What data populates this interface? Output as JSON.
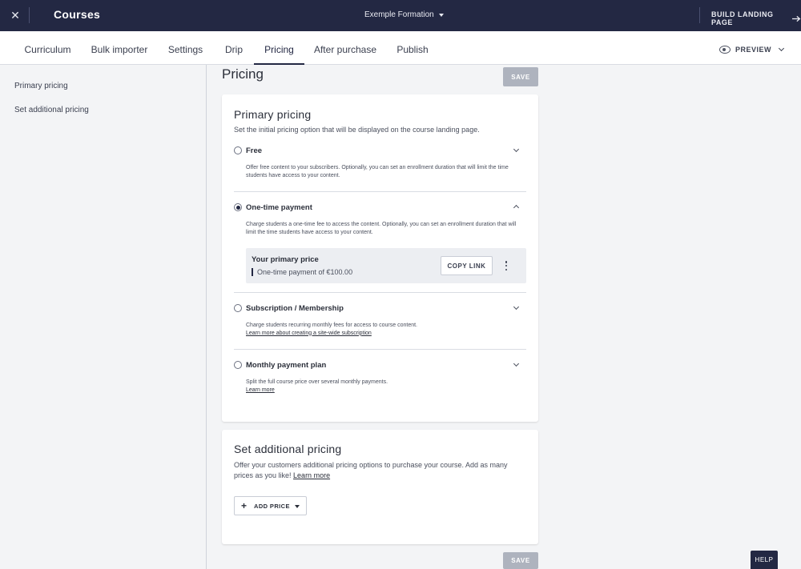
{
  "topbar": {
    "close_icon": "close-icon",
    "brand": "Courses",
    "course_selector": "Exemple Formation",
    "build_landing": "BUILD LANDING PAGE"
  },
  "tabs": [
    {
      "label": "Curriculum"
    },
    {
      "label": "Bulk importer"
    },
    {
      "label": "Settings"
    },
    {
      "label": "Drip"
    },
    {
      "label": "Pricing",
      "active": true
    },
    {
      "label": "After purchase"
    },
    {
      "label": "Publish"
    }
  ],
  "preview_label": "PREVIEW",
  "sidebar": {
    "items": [
      {
        "label": "Primary pricing"
      },
      {
        "label": "Set additional pricing"
      }
    ]
  },
  "main": {
    "title": "Pricing",
    "save_label": "SAVE",
    "primary": {
      "heading": "Primary pricing",
      "subtitle": "Set the initial pricing option that will be displayed on the course landing page.",
      "options": [
        {
          "label": "Free",
          "selected": false,
          "desc": "Offer free content to your subscribers. Optionally, you can set an enrollment duration that will limit the time students have access to your content."
        },
        {
          "label": "One-time payment",
          "selected": true,
          "desc": "Charge students a one-time fee to access the content. Optionally, you can set an enrollment duration that will limit the time students have access to your content.",
          "price_title": "Your primary price",
          "price_value": "One-time payment of €100.00",
          "copy_link": "COPY LINK"
        },
        {
          "label": "Subscription / Membership",
          "selected": false,
          "desc": "Charge students recurring monthly fees for access to course content.",
          "link": "Learn more about creating a site-wide subscription"
        },
        {
          "label": "Monthly payment plan",
          "selected": false,
          "desc": "Split the full course price over several monthly payments.",
          "link": "Learn more"
        }
      ]
    },
    "additional": {
      "heading": "Set additional pricing",
      "text": "Offer your customers additional pricing options to purchase your course. Add as many prices as you like!",
      "link": "Learn more",
      "add_price": "ADD PRICE"
    }
  },
  "help_label": "HELP",
  "colors": {
    "topbar": "#232843",
    "save_disabled": "#aeb3be"
  }
}
